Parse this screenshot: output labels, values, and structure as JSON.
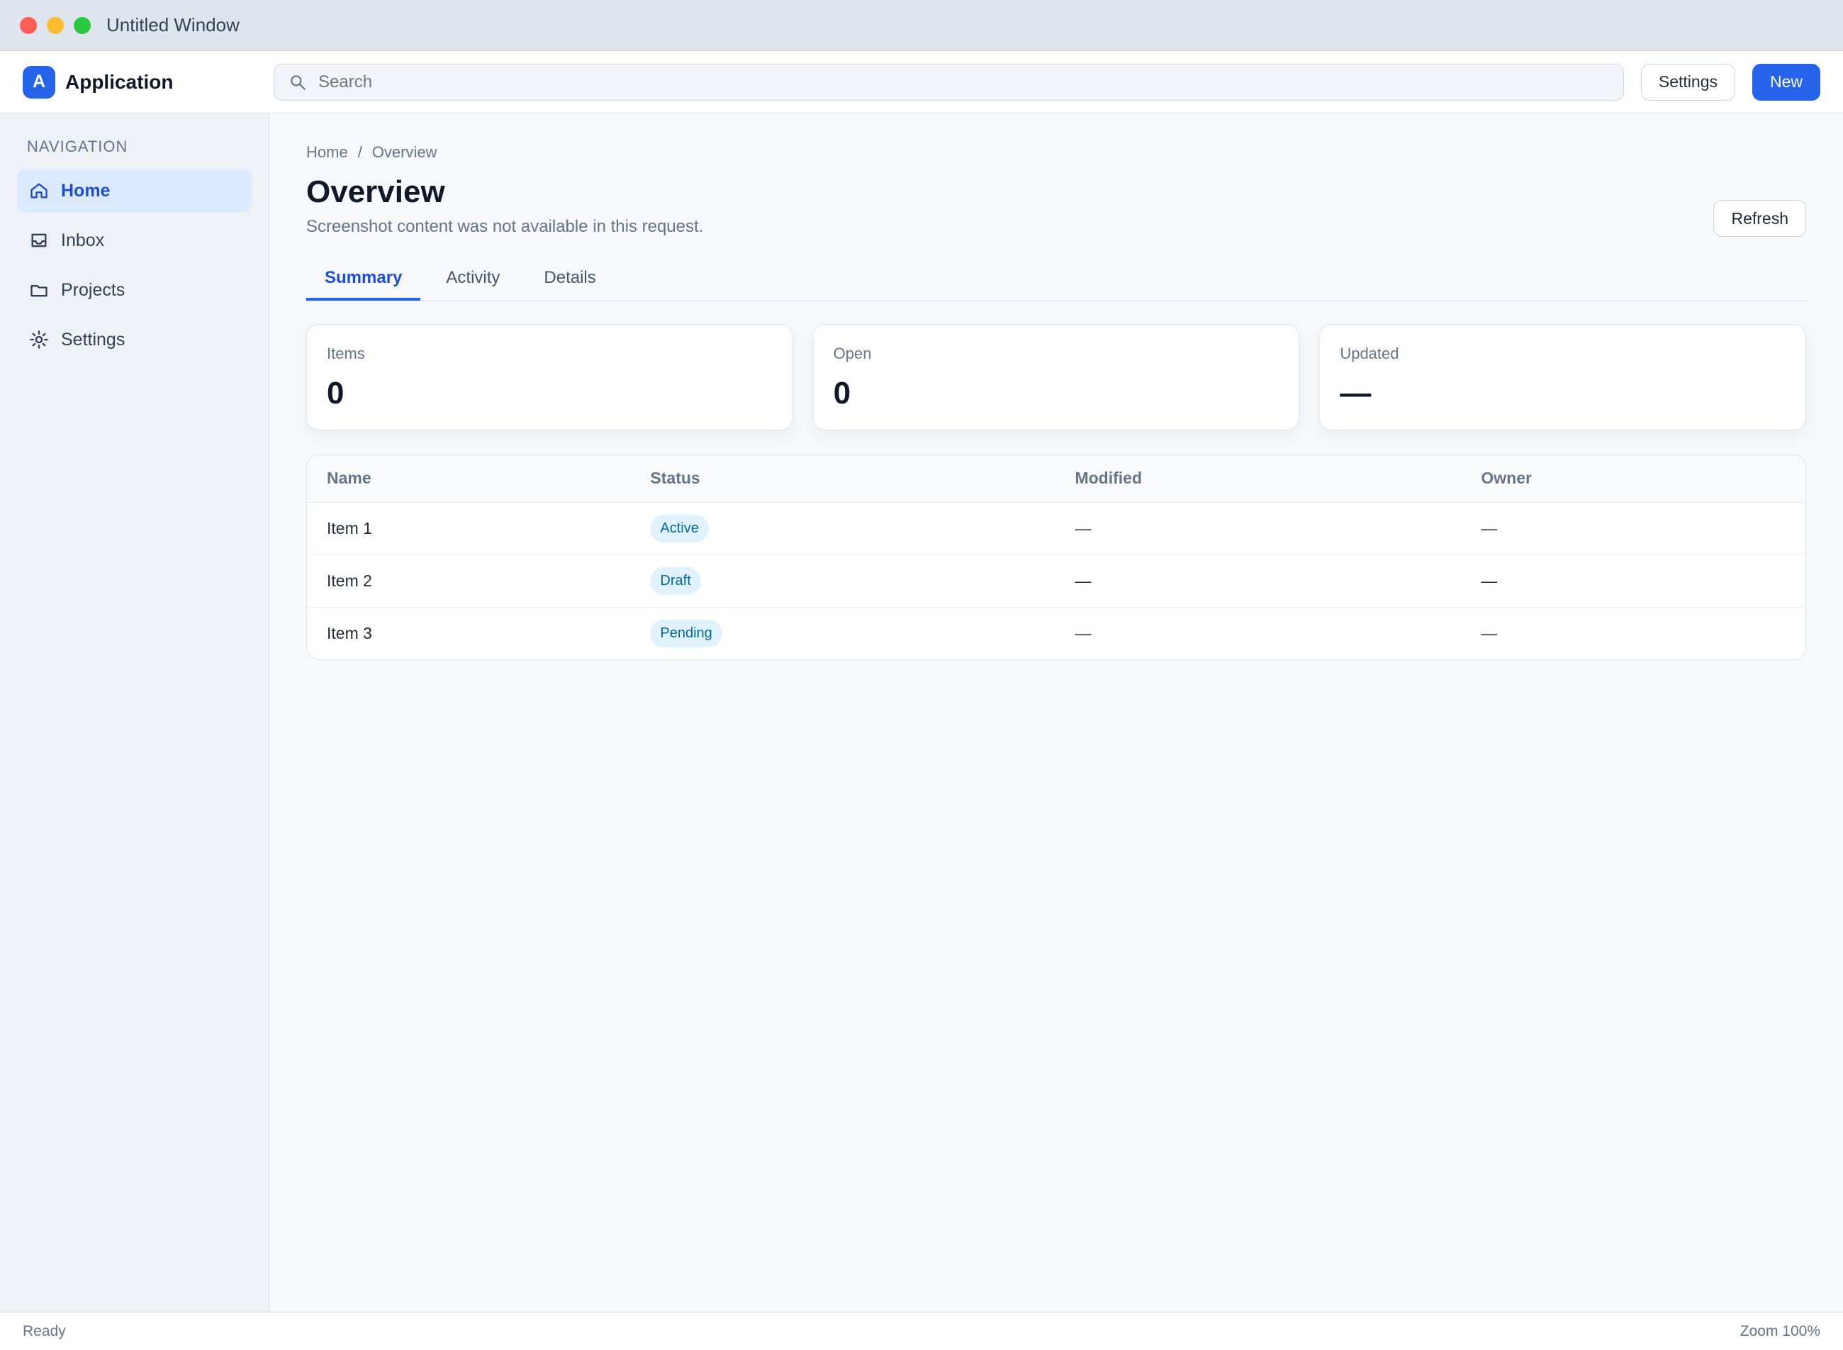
{
  "window": {
    "title": "Untitled Window"
  },
  "app": {
    "name": "Application"
  },
  "search": {
    "value": "",
    "placeholder": "Search"
  },
  "toolbar": {
    "primary_label": "New",
    "secondary_label": "Settings"
  },
  "sidebar": {
    "heading": "Navigation",
    "items": [
      {
        "label": "Home"
      },
      {
        "label": "Inbox"
      },
      {
        "label": "Projects"
      },
      {
        "label": "Settings"
      }
    ]
  },
  "main": {
    "breadcrumb": [
      "Home",
      "Overview"
    ],
    "title": "Overview",
    "subtitle": "Screenshot content was not available in this request.",
    "header_action": "Refresh",
    "tabs": [
      "Summary",
      "Activity",
      "Details"
    ]
  },
  "cards": [
    {
      "label": "Items",
      "value": "0"
    },
    {
      "label": "Open",
      "value": "0"
    },
    {
      "label": "Updated",
      "value": "—"
    }
  ],
  "table": {
    "headers": [
      "Name",
      "Status",
      "Modified",
      "Owner"
    ],
    "rows": [
      [
        "Item 1",
        "Active",
        "—",
        "—"
      ],
      [
        "Item 2",
        "Draft",
        "—",
        "—"
      ],
      [
        "Item 3",
        "Pending",
        "—",
        "—"
      ]
    ]
  },
  "status": {
    "left": "Ready",
    "right": "Zoom 100%"
  },
  "icons": {
    "search": "search-icon",
    "home": "home-icon",
    "inbox": "inbox-icon",
    "folder": "folder-icon",
    "gear": "gear-icon"
  },
  "colors": {
    "accent": "#2563eb",
    "surface": "#ffffff",
    "background": "#f6f8fb"
  }
}
